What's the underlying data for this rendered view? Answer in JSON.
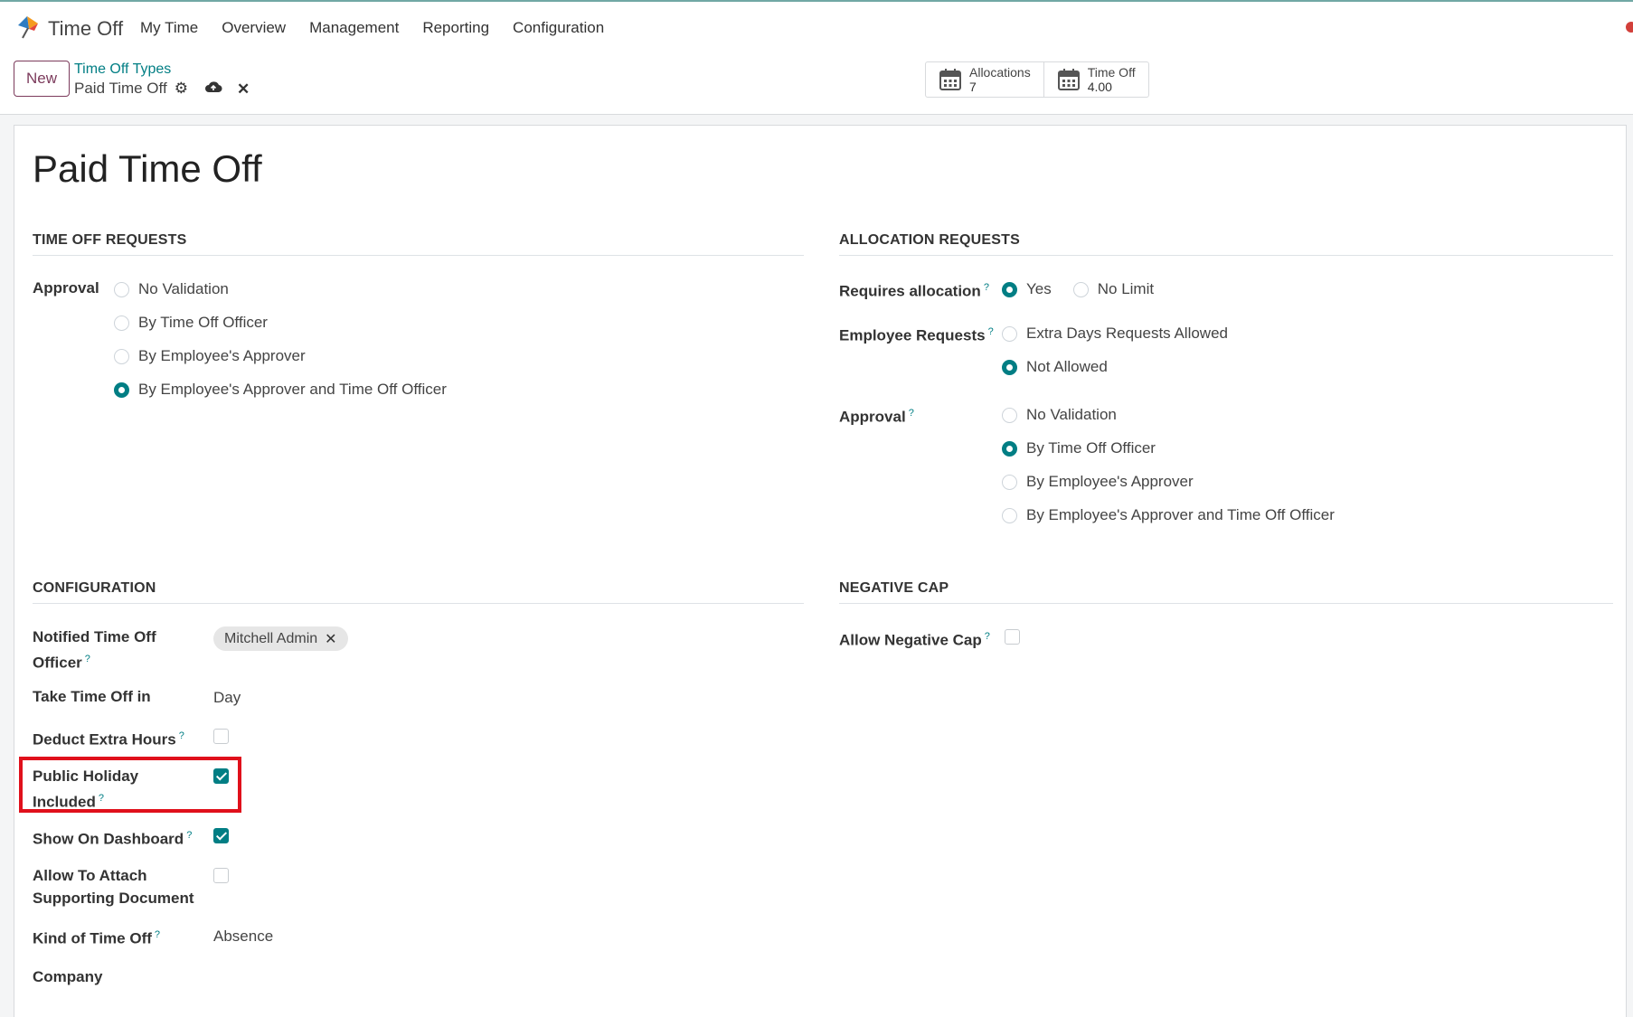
{
  "navbar": {
    "app_name": "Time Off",
    "menu": [
      "My Time",
      "Overview",
      "Management",
      "Reporting",
      "Configuration"
    ]
  },
  "control_panel": {
    "new_label": "New",
    "breadcrumb_parent": "Time Off Types",
    "breadcrumb_current": "Paid Time Off",
    "stats": [
      {
        "label": "Allocations",
        "value": "7",
        "icon": "calendar-icon"
      },
      {
        "label": "Time Off",
        "value": "4.00",
        "icon": "calendar-icon"
      }
    ]
  },
  "form": {
    "title": "Paid Time Off",
    "time_off_requests": {
      "section": "TIME OFF REQUESTS",
      "approval_label": "Approval",
      "approval_options": [
        "No Validation",
        "By Time Off Officer",
        "By Employee's Approver",
        "By Employee's Approver and Time Off Officer"
      ],
      "approval_selected": "By Employee's Approver and Time Off Officer"
    },
    "allocation_requests": {
      "section": "ALLOCATION REQUESTS",
      "requires_allocation_label": "Requires allocation",
      "requires_allocation_options": [
        "Yes",
        "No Limit"
      ],
      "requires_allocation_selected": "Yes",
      "employee_requests_label": "Employee Requests",
      "employee_requests_options": [
        "Extra Days Requests Allowed",
        "Not Allowed"
      ],
      "employee_requests_selected": "Not Allowed",
      "approval_label": "Approval",
      "approval_options": [
        "No Validation",
        "By Time Off Officer",
        "By Employee's Approver",
        "By Employee's Approver and Time Off Officer"
      ],
      "approval_selected": "By Time Off Officer"
    },
    "configuration": {
      "section": "CONFIGURATION",
      "notified_officer_label_1": "Notified Time Off",
      "notified_officer_label_2": "Officer",
      "notified_officer_value": "Mitchell Admin",
      "take_time_off_label": "Take Time Off in",
      "take_time_off_value": "Day",
      "deduct_extra_hours_label": "Deduct Extra Hours",
      "deduct_extra_hours": false,
      "public_holiday_label_1": "Public Holiday",
      "public_holiday_label_2": "Included",
      "public_holiday": true,
      "show_dashboard_label": "Show On Dashboard",
      "show_dashboard": true,
      "attach_doc_label_1": "Allow To Attach",
      "attach_doc_label_2": "Supporting Document",
      "attach_doc": false,
      "kind_label": "Kind of Time Off",
      "kind_value": "Absence",
      "company_label": "Company"
    },
    "negative_cap": {
      "section": "NEGATIVE CAP",
      "allow_label": "Allow Negative Cap",
      "allow": false
    },
    "help_marker": "?"
  },
  "colors": {
    "accent": "#017e84",
    "brand": "#7c3b5c",
    "highlight": "#e0101b"
  }
}
